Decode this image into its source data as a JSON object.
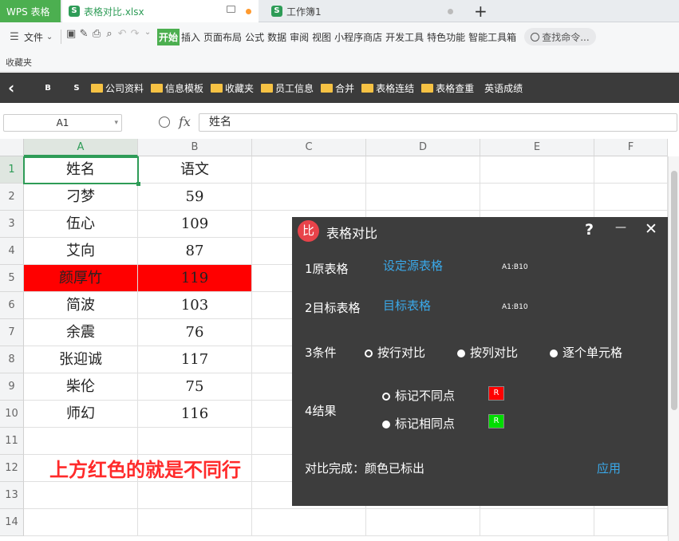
{
  "tabs": {
    "wps": "WPS 表格",
    "file": "表格对比.xlsx",
    "book": "工作簿1",
    "new_tab": "+"
  },
  "toolbar": {
    "menu_file": "文件",
    "ribbon": [
      "开始",
      "插入",
      "页面布局",
      "公式",
      "数据",
      "审阅",
      "视图",
      "小程序商店",
      "开发工具",
      "特色功能",
      "智能工具箱"
    ],
    "search": "查找命令..."
  },
  "favorites": "收藏夹",
  "bookmarks": {
    "nav_back": "‹",
    "b1": "B",
    "b2": "S",
    "items": [
      "公司资料",
      "信息模板",
      "收藏夹",
      "员工信息",
      "合并",
      "表格连结",
      "表格查重"
    ],
    "plain": "英语成绩"
  },
  "formula": {
    "cell_ref": "A1",
    "value": "姓名"
  },
  "sheet": {
    "columns": [
      "A",
      "B",
      "C",
      "D",
      "E",
      "F"
    ],
    "rows": [
      "1",
      "2",
      "3",
      "4",
      "5",
      "6",
      "7",
      "8",
      "9",
      "10",
      "11",
      "12",
      "13",
      "14"
    ],
    "data": [
      [
        "姓名",
        "语文"
      ],
      [
        "刁梦",
        "59"
      ],
      [
        "伍心",
        "109"
      ],
      [
        "艾向",
        "87"
      ],
      [
        "颜厚竹",
        "119"
      ],
      [
        "简波",
        "103"
      ],
      [
        "余震",
        "76"
      ],
      [
        "张迎诚",
        "117"
      ],
      [
        "柴伦",
        "75"
      ],
      [
        "师幻",
        "116"
      ]
    ],
    "highlight_row": 5,
    "highlight_color": "#ff0000",
    "annotation": "上方红色的就是不同行",
    "annotation_color": "#ff2a2a"
  },
  "dialog": {
    "logo": "比",
    "title": "表格对比",
    "help": "?",
    "minimize": "—",
    "close": "✕",
    "src_label": "1原表格",
    "src_link": "设定源表格",
    "src_range": "A1:B10",
    "tgt_label": "2目标表格",
    "tgt_link": "目标表格",
    "tgt_range": "A1:B10",
    "cond_label": "3条件",
    "cond_options": [
      "按行对比",
      "按列对比",
      "逐个单元格"
    ],
    "result_label": "4结果",
    "result_options": [
      "标记不同点",
      "标记相同点"
    ],
    "diff_swatch": "R",
    "same_swatch": "R",
    "diff_color": "#ff0000",
    "same_color": "#00dd00",
    "status": "对比完成：颜色已标出",
    "apply": "应用"
  }
}
